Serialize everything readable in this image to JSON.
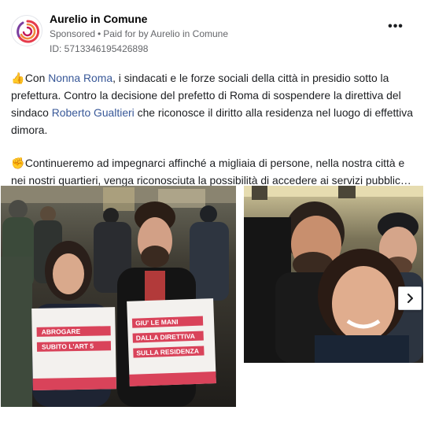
{
  "ad": {
    "page_name": "Aurelio in Comune",
    "sponsored_label": "Sponsored",
    "separator": "•",
    "paid_for_text": "Paid for by Aurelio in Comune",
    "ad_id_text": "ID: 5713346195426898",
    "more_label": "•••"
  },
  "body": {
    "p1": {
      "emoji": "👍",
      "t1": " Con ",
      "link1": "Nonna Roma",
      "t2": ", i sindacati e le forze sociali della città in presidio sotto la prefettura. Contro la decisione del prefetto di Roma di sospendere la direttiva del sindaco ",
      "link2": "Roberto Gualtieri",
      "t3": " che riconosce il diritto alla residenza nel luogo di effettiva dimora."
    },
    "p2": {
      "emoji": "✊",
      "text": " Continueremo ad impegnarci affinché a migliaia di persone, nella nostra città e nei nostri quartieri, venga riconosciuta la possibilità di accedere ai servizi pubblic…"
    }
  },
  "images": {
    "sign1_line1": "ABROGARE",
    "sign1_line2": "SUBITO L'ART 5",
    "sign2_line1": "GIU' LE MANI",
    "sign2_line2": "DALLA DIRETTIVA",
    "sign2_line3": "SULLA RESIDENZA"
  },
  "colors": {
    "link": "#385898",
    "sign_red": "#d9435a",
    "logo_red": "#e63b4b"
  },
  "icons": {
    "logo": "spiral-logo-icon",
    "next": "chevron-right-icon"
  }
}
